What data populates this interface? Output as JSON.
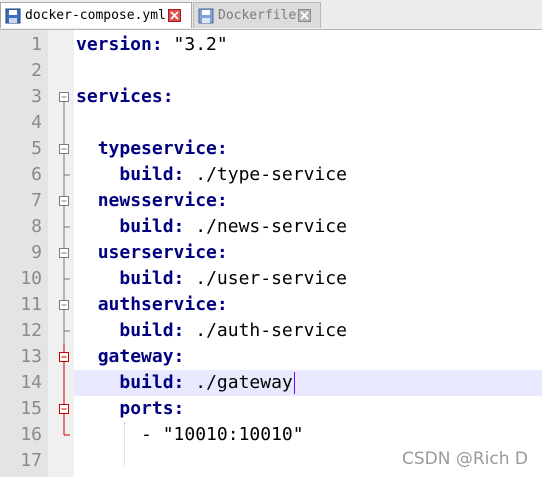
{
  "tabs": [
    {
      "label": "docker-compose.yml",
      "active": true
    },
    {
      "label": "Dockerfile",
      "active": false
    }
  ],
  "editor": {
    "current_line": 14,
    "lines": [
      {
        "num": "1",
        "indent": "",
        "key": "version",
        "rest": " \"3.2\"",
        "fold": "none"
      },
      {
        "num": "2",
        "indent": "",
        "key": "",
        "rest": "",
        "fold": "none"
      },
      {
        "num": "3",
        "indent": "",
        "key": "services",
        "rest": ":",
        "fold": "open"
      },
      {
        "num": "4",
        "indent": "",
        "key": "",
        "rest": "",
        "fold": "line"
      },
      {
        "num": "5",
        "indent": "  ",
        "key": "typeservice",
        "rest": ":",
        "fold": "open"
      },
      {
        "num": "6",
        "indent": "    ",
        "key": "build",
        "rest": " ./type-service",
        "fold": "end"
      },
      {
        "num": "7",
        "indent": "  ",
        "key": "newsservice",
        "rest": ":",
        "fold": "open"
      },
      {
        "num": "8",
        "indent": "    ",
        "key": "build",
        "rest": " ./news-service",
        "fold": "end"
      },
      {
        "num": "9",
        "indent": "  ",
        "key": "userservice",
        "rest": ":",
        "fold": "open"
      },
      {
        "num": "10",
        "indent": "    ",
        "key": "build",
        "rest": " ./user-service",
        "fold": "end"
      },
      {
        "num": "11",
        "indent": "  ",
        "key": "authservice",
        "rest": ":",
        "fold": "open"
      },
      {
        "num": "12",
        "indent": "    ",
        "key": "build",
        "rest": " ./auth-service",
        "fold": "end"
      },
      {
        "num": "13",
        "indent": "  ",
        "key": "gateway",
        "rest": ":",
        "fold": "open-red"
      },
      {
        "num": "14",
        "indent": "    ",
        "key": "build",
        "rest": " ./gateway",
        "fold": "line-red"
      },
      {
        "num": "15",
        "indent": "    ",
        "key": "ports",
        "rest": ":",
        "fold": "open-red"
      },
      {
        "num": "16",
        "indent": "      ",
        "key": "",
        "rest": "- \"10010:10010\"",
        "fold": "end-red"
      },
      {
        "num": "17",
        "indent": "",
        "key": "",
        "rest": "",
        "fold": "none"
      }
    ]
  },
  "watermark": "CSDN @Rich D",
  "colors": {
    "keyword": "#000080",
    "fold_active": "#cc0000",
    "current_line_bg": "#e8e8ff",
    "caret": "#8000ff"
  }
}
